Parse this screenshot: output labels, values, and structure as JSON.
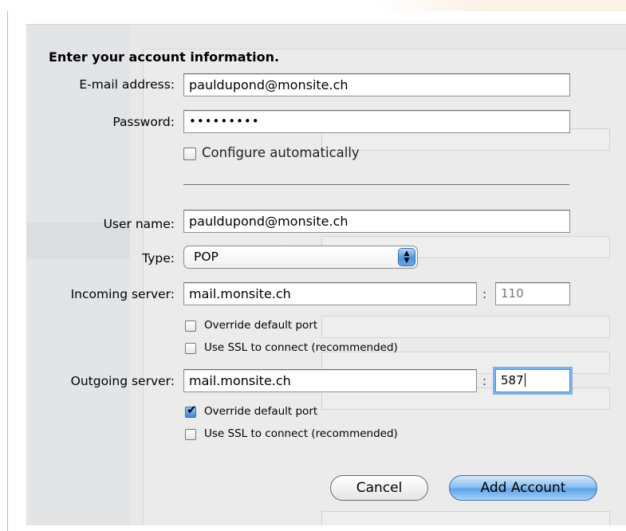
{
  "heading": "Enter your account information.",
  "fields": {
    "email": {
      "label": "E-mail address:",
      "value": "pauldupond@monsite.ch"
    },
    "password": {
      "label": "Password:",
      "value": "•••••••••"
    },
    "configure_auto": {
      "label": "Configure automatically",
      "checked": false
    },
    "username": {
      "label": "User name:",
      "value": "pauldupond@monsite.ch"
    },
    "type": {
      "label": "Type:",
      "value": "POP"
    }
  },
  "incoming": {
    "label": "Incoming server:",
    "server": "mail.monsite.ch",
    "port_sep": ":",
    "port": "110",
    "override_label": "Override default port",
    "override_checked": false,
    "ssl_label": "Use SSL to connect (recommended)",
    "ssl_checked": false
  },
  "outgoing": {
    "label": "Outgoing server:",
    "server": "mail.monsite.ch",
    "port_sep": ":",
    "port": "587",
    "override_label": "Override default port",
    "override_checked": true,
    "ssl_label": "Use SSL to connect (recommended)",
    "ssl_checked": false
  },
  "buttons": {
    "cancel": "Cancel",
    "add": "Add Account"
  },
  "icons": {
    "checkmark": "✔",
    "stepper": "▲▼"
  }
}
